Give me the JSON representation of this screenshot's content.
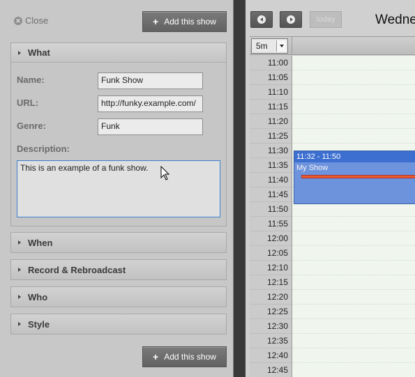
{
  "left_panel": {
    "close_label": "Close",
    "add_show_label": "Add this show",
    "sections": {
      "what": "What",
      "when": "When",
      "record": "Record & Rebroadcast",
      "who": "Who",
      "style": "Style"
    },
    "fields": {
      "name_label": "Name:",
      "name_value": "Funk Show",
      "url_label": "URL:",
      "url_value": "http://funky.example.com/",
      "genre_label": "Genre:",
      "genre_value": "Funk",
      "description_label": "Description:",
      "description_value": "This is an example of a funk show."
    }
  },
  "calendar": {
    "today_label": "today",
    "date_title": "Wedne",
    "slot_size": "5m",
    "times": [
      "11:00",
      "11:05",
      "11:10",
      "11:15",
      "11:20",
      "11:25",
      "11:30",
      "11:35",
      "11:40",
      "11:45",
      "11:50",
      "11:55",
      "12:00",
      "12:05",
      "12:10",
      "12:15",
      "12:20",
      "12:25",
      "12:30",
      "12:35",
      "12:40",
      "12:45"
    ],
    "event": {
      "time_range": "11:32 - 11:50",
      "title": "My Show",
      "color": "#6e93dd",
      "header_color": "#3c6fd0",
      "bar_color": "#ec5b2c"
    }
  }
}
